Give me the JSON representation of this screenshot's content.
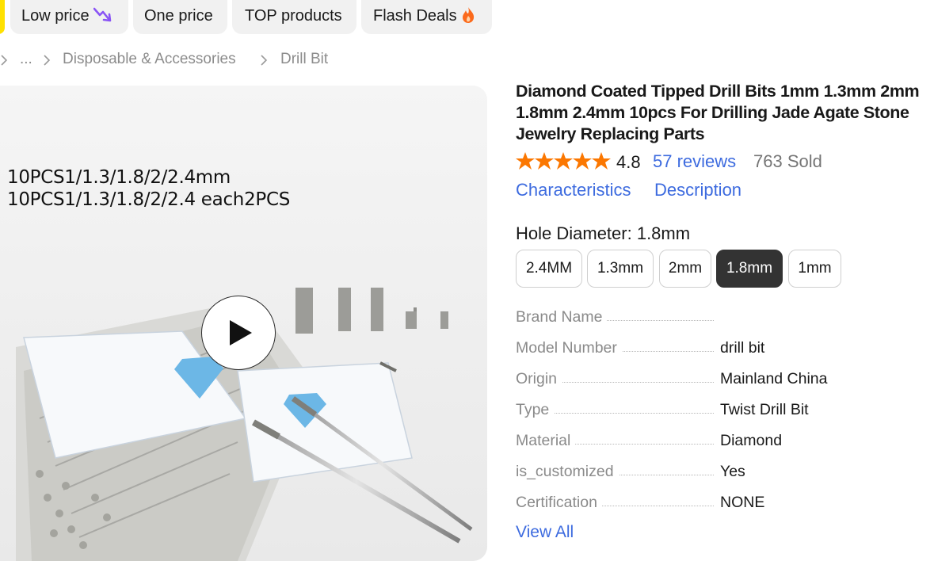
{
  "filter_chips": [
    {
      "label": "Low price",
      "icon": "trending-down-icon",
      "icon_color": "#8a54f5"
    },
    {
      "label": "One price"
    },
    {
      "label": "TOP products"
    },
    {
      "label": "Flash Deals",
      "icon": "flame-icon",
      "icon_color": "#fb6a1c"
    }
  ],
  "breadcrumb": {
    "ellipsis": "...",
    "items": [
      "Disposable & Accessories",
      "Drill Bit"
    ]
  },
  "media": {
    "caption_line1": "10PCS1/1.3/1.8/2/2.4mm",
    "caption_line2": "10PCS1/1.3/1.8/2/2.4 each2PCS",
    "play_icon": "play-icon"
  },
  "product": {
    "title": "Diamond Coated Tipped Drill Bits 1mm 1.3mm 2mm 1.8mm 2.4mm 10pcs For Drilling Jade Agate Stone Jewelry Replacing Parts",
    "rating": "4.8",
    "star_count": 5,
    "star_color": "#fb7701",
    "reviews": "57 reviews",
    "sold": "763 Sold"
  },
  "tabs": [
    "Characteristics",
    "Description"
  ],
  "option": {
    "label": "Hole Diameter: 1.8mm",
    "choices": [
      "2.4MM",
      "1.3mm",
      "2mm",
      "1.8mm",
      "1mm"
    ],
    "selected": "1.8mm"
  },
  "specs": [
    {
      "key": "Brand Name",
      "value": ""
    },
    {
      "key": "Model Number",
      "value": "drill bit"
    },
    {
      "key": "Origin",
      "value": "Mainland China"
    },
    {
      "key": "Type",
      "value": "Twist Drill Bit"
    },
    {
      "key": "Material",
      "value": "Diamond"
    },
    {
      "key": "is_customized",
      "value": "Yes"
    },
    {
      "key": "Certification",
      "value": "NONE"
    }
  ],
  "view_all": "View All",
  "colors": {
    "link": "#3d6bdf",
    "selected_option": "#333333",
    "yellow_accent": "#ffe100"
  }
}
